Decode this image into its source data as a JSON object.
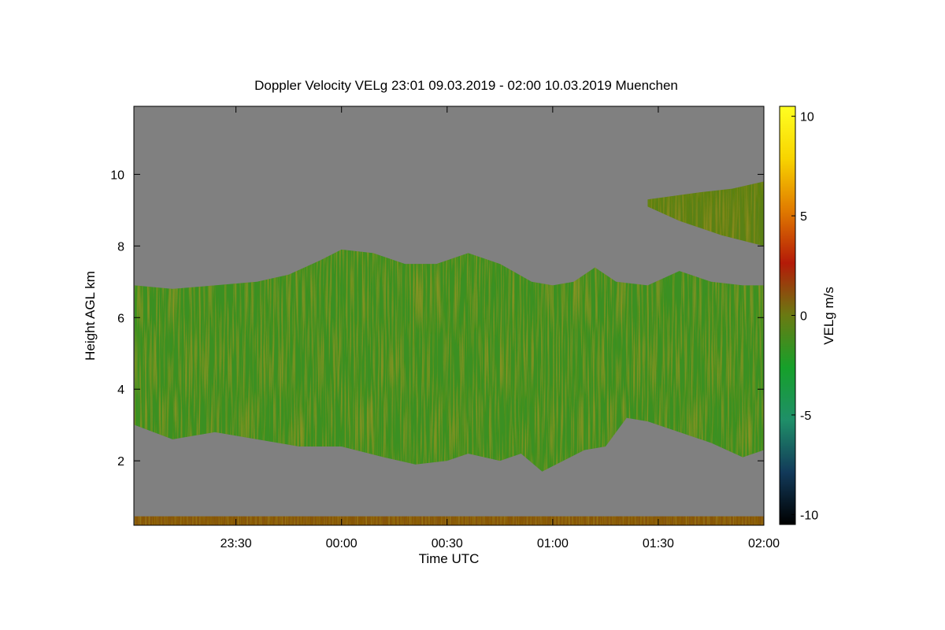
{
  "chart_data": {
    "type": "heatmap",
    "title": "Doppler Velocity VELg   23:01 09.03.2019 - 02:00 10.03.2019 Muenchen",
    "xlabel": "Time UTC",
    "ylabel": "Height AGL km",
    "colorbar_label": "VELg m/s",
    "x_range_utc": [
      "23:01",
      "02:00"
    ],
    "x_ticks": [
      "23:30",
      "00:00",
      "00:30",
      "01:00",
      "01:30",
      "02:00"
    ],
    "y_range_km": [
      0.2,
      11.9
    ],
    "y_ticks": [
      2,
      4,
      6,
      8,
      10
    ],
    "color_range": [
      -10.5,
      10.5
    ],
    "color_ticks": [
      -10,
      -5,
      0,
      5,
      10
    ],
    "colormap": [
      "#000000",
      "#123a5a",
      "#1f8f68",
      "#16a02a",
      "#6a7a12",
      "#b41a08",
      "#e07a00",
      "#f8d400",
      "#ffff22"
    ],
    "background_color": "#808080",
    "layers": [
      {
        "name": "main cloud layer",
        "mean_velocity_ms": -1.5,
        "top_km": [
          [
            23.02,
            6.9
          ],
          [
            23.2,
            6.8
          ],
          [
            23.4,
            6.9
          ],
          [
            23.6,
            7.0
          ],
          [
            23.75,
            7.2
          ],
          [
            23.9,
            7.6
          ],
          [
            24.0,
            7.9
          ],
          [
            24.15,
            7.8
          ],
          [
            24.3,
            7.5
          ],
          [
            24.45,
            7.5
          ],
          [
            24.6,
            7.8
          ],
          [
            24.75,
            7.5
          ],
          [
            24.9,
            7.0
          ],
          [
            25.0,
            6.9
          ],
          [
            25.1,
            7.0
          ],
          [
            25.2,
            7.4
          ],
          [
            25.3,
            7.0
          ],
          [
            25.45,
            6.9
          ],
          [
            25.6,
            7.3
          ],
          [
            25.75,
            7.0
          ],
          [
            25.9,
            6.9
          ],
          [
            26.0,
            6.9
          ]
        ],
        "base_km": [
          [
            23.02,
            3.0
          ],
          [
            23.2,
            2.6
          ],
          [
            23.4,
            2.8
          ],
          [
            23.6,
            2.6
          ],
          [
            23.8,
            2.4
          ],
          [
            24.0,
            2.4
          ],
          [
            24.2,
            2.1
          ],
          [
            24.35,
            1.9
          ],
          [
            24.5,
            2.0
          ],
          [
            24.6,
            2.2
          ],
          [
            24.75,
            2.0
          ],
          [
            24.85,
            2.2
          ],
          [
            24.95,
            1.7
          ],
          [
            25.05,
            2.0
          ],
          [
            25.15,
            2.3
          ],
          [
            25.25,
            2.4
          ],
          [
            25.35,
            3.2
          ],
          [
            25.45,
            3.1
          ],
          [
            25.6,
            2.8
          ],
          [
            25.75,
            2.5
          ],
          [
            25.9,
            2.1
          ],
          [
            26.0,
            2.3
          ]
        ]
      },
      {
        "name": "upper cloud layer",
        "mean_velocity_ms": -0.5,
        "top_km": [
          [
            25.45,
            9.3
          ],
          [
            25.7,
            9.5
          ],
          [
            25.85,
            9.6
          ],
          [
            26.0,
            9.8
          ]
        ],
        "base_km": [
          [
            25.45,
            9.1
          ],
          [
            25.6,
            8.7
          ],
          [
            25.8,
            8.3
          ],
          [
            26.0,
            8.0
          ]
        ]
      },
      {
        "name": "surface clutter",
        "mean_velocity_ms": 1.0,
        "top_km": [
          [
            23.02,
            0.45
          ],
          [
            26.0,
            0.45
          ]
        ],
        "base_km": [
          [
            23.02,
            0.2
          ],
          [
            26.0,
            0.2
          ]
        ]
      }
    ]
  }
}
